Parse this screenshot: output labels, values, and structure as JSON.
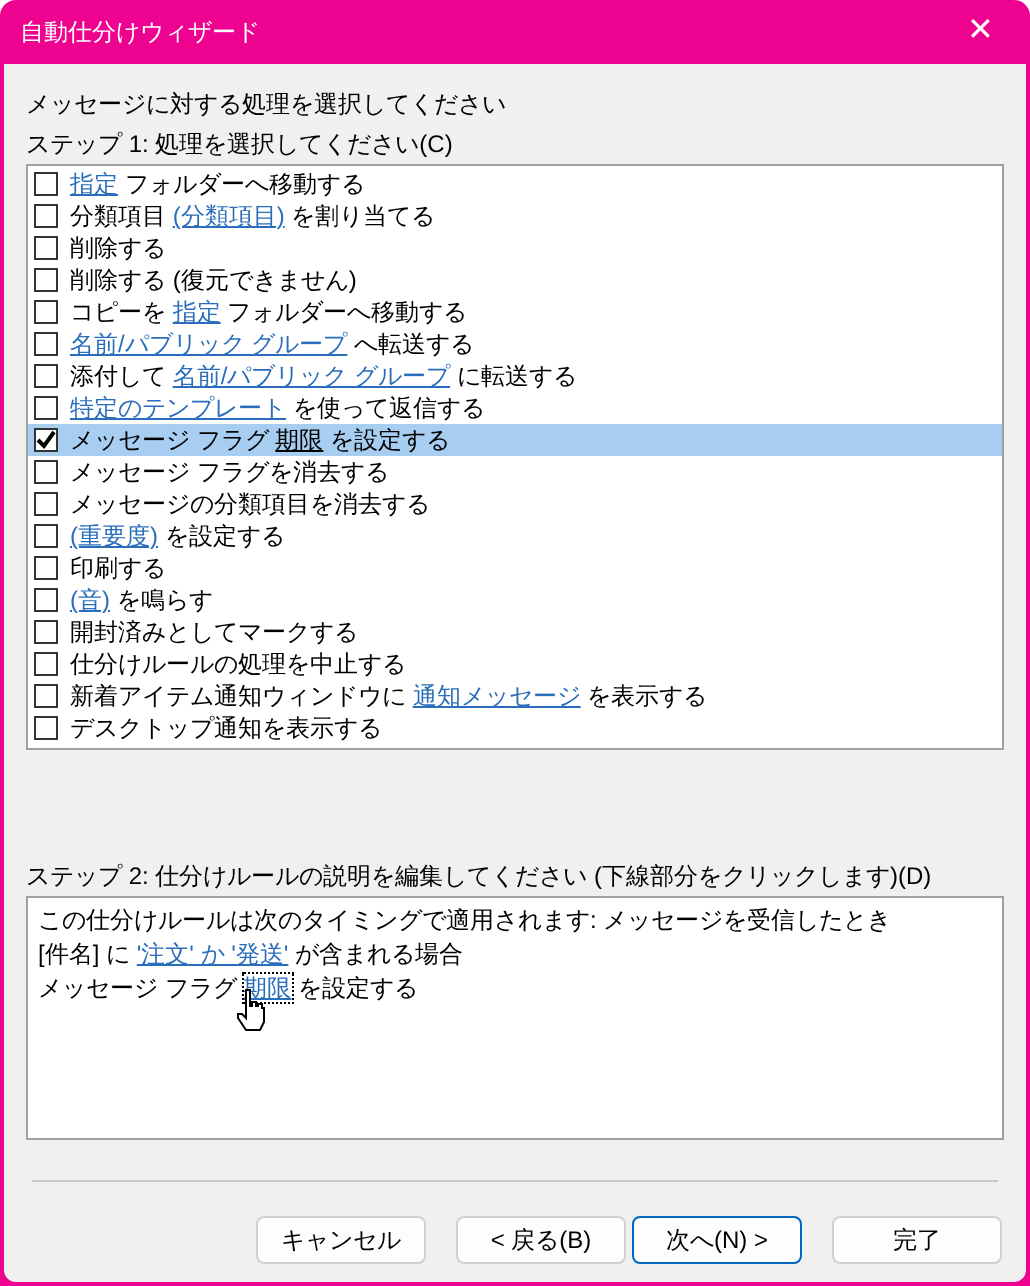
{
  "window": {
    "title": "自動仕分けウィザード",
    "close": "✕"
  },
  "heading": "メッセージに対する処理を選択してください",
  "step1": {
    "label": "ステップ 1: 処理を選択してください(C)",
    "items": [
      {
        "checked": false,
        "selected": false,
        "parts": [
          {
            "text": "指定",
            "link": true
          },
          {
            "text": " フォルダーへ移動する",
            "link": false
          }
        ]
      },
      {
        "checked": false,
        "selected": false,
        "parts": [
          {
            "text": "分類項目 ",
            "link": false
          },
          {
            "text": "(分類項目)",
            "link": true
          },
          {
            "text": " を割り当てる",
            "link": false
          }
        ]
      },
      {
        "checked": false,
        "selected": false,
        "parts": [
          {
            "text": "削除する",
            "link": false
          }
        ]
      },
      {
        "checked": false,
        "selected": false,
        "parts": [
          {
            "text": "削除する (復元できません)",
            "link": false
          }
        ]
      },
      {
        "checked": false,
        "selected": false,
        "parts": [
          {
            "text": "コピーを ",
            "link": false
          },
          {
            "text": "指定",
            "link": true
          },
          {
            "text": " フォルダーへ移動する",
            "link": false
          }
        ]
      },
      {
        "checked": false,
        "selected": false,
        "parts": [
          {
            "text": "名前/パブリック グループ",
            "link": true
          },
          {
            "text": " へ転送する",
            "link": false
          }
        ]
      },
      {
        "checked": false,
        "selected": false,
        "parts": [
          {
            "text": "添付して ",
            "link": false
          },
          {
            "text": "名前/パブリック グループ",
            "link": true
          },
          {
            "text": " に転送する",
            "link": false
          }
        ]
      },
      {
        "checked": false,
        "selected": false,
        "parts": [
          {
            "text": "特定のテンプレート",
            "link": true
          },
          {
            "text": " を使って返信する",
            "link": false
          }
        ]
      },
      {
        "checked": true,
        "selected": true,
        "parts": [
          {
            "text": "メッセージ フラグ ",
            "link": false
          },
          {
            "text": "期限",
            "link": true
          },
          {
            "text": " を設定する",
            "link": false
          }
        ]
      },
      {
        "checked": false,
        "selected": false,
        "parts": [
          {
            "text": "メッセージ フラグを消去する",
            "link": false
          }
        ]
      },
      {
        "checked": false,
        "selected": false,
        "parts": [
          {
            "text": "メッセージの分類項目を消去する",
            "link": false
          }
        ]
      },
      {
        "checked": false,
        "selected": false,
        "parts": [
          {
            "text": "(重要度)",
            "link": true
          },
          {
            "text": " を設定する",
            "link": false
          }
        ]
      },
      {
        "checked": false,
        "selected": false,
        "parts": [
          {
            "text": "印刷する",
            "link": false
          }
        ]
      },
      {
        "checked": false,
        "selected": false,
        "parts": [
          {
            "text": "(音)",
            "link": true
          },
          {
            "text": " を鳴らす",
            "link": false
          }
        ]
      },
      {
        "checked": false,
        "selected": false,
        "parts": [
          {
            "text": "開封済みとしてマークする",
            "link": false
          }
        ]
      },
      {
        "checked": false,
        "selected": false,
        "parts": [
          {
            "text": "仕分けルールの処理を中止する",
            "link": false
          }
        ]
      },
      {
        "checked": false,
        "selected": false,
        "parts": [
          {
            "text": "新着アイテム通知ウィンドウに ",
            "link": false
          },
          {
            "text": "通知メッセージ",
            "link": true
          },
          {
            "text": " を表示する",
            "link": false
          }
        ]
      },
      {
        "checked": false,
        "selected": false,
        "parts": [
          {
            "text": "デスクトップ通知を表示する",
            "link": false
          }
        ]
      }
    ]
  },
  "step2": {
    "label": "ステップ 2: 仕分けルールの説明を編集してください (下線部分をクリックします)(D)",
    "lines": [
      [
        {
          "text": "この仕分けルールは次のタイミングで適用されます: メッセージを受信したとき",
          "link": false
        }
      ],
      [
        {
          "text": "[件名] に ",
          "link": false
        },
        {
          "text": "'注文' か '発送'",
          "link": true
        },
        {
          "text": " が含まれる場合",
          "link": false
        }
      ],
      [
        {
          "text": "メッセージ フラグ ",
          "link": false
        },
        {
          "text": "期限",
          "link": true,
          "focused": true
        },
        {
          "text": " を設定する",
          "link": false
        }
      ]
    ]
  },
  "buttons": [
    {
      "label": "キャンセル",
      "default": false
    },
    {
      "label": "< 戻る(B)",
      "default": false
    },
    {
      "label": "次へ(N) >",
      "default": true
    },
    {
      "label": "完了",
      "default": false
    }
  ]
}
